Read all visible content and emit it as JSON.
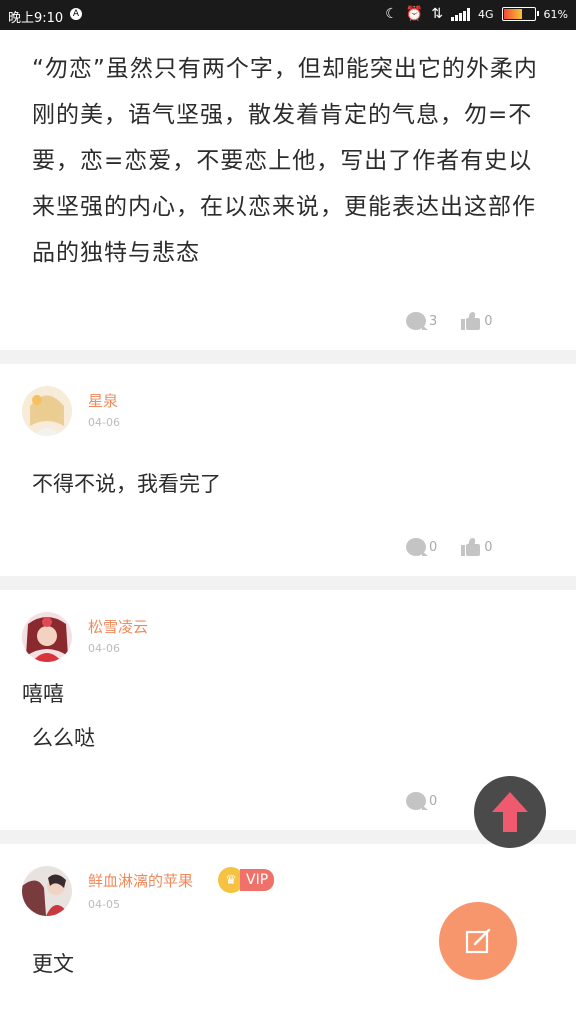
{
  "status_bar": {
    "time": "晚上9:10",
    "notification_badge": "A",
    "network": "4G",
    "battery": "61%",
    "icons": [
      "moon-icon",
      "alarm-icon",
      "data-transfer-icon",
      "signal-icon",
      "battery-icon"
    ]
  },
  "posts": [
    {
      "text": "“勿恋”虽然只有两个字，但却能突出它的外柔内刚的美，语气坚强，散发着肯定的气息，勿=不要，恋=恋爱，不要恋上他，写出了作者有史以来坚强的内心，在以恋来说，更能表达出这部作品的独特与悲态",
      "reply_count": "3",
      "like_count": "0"
    }
  ],
  "comments": [
    {
      "username": "星泉",
      "date": "04-06",
      "text": "不得不说，我看完了",
      "reply_count": "0",
      "like_count": "0"
    },
    {
      "username": "松雪凌云",
      "date": "04-06",
      "text_line1": "嘻嘻",
      "text_line2": "么么哒",
      "reply_count": "0"
    },
    {
      "username": "鲜血淋漓的苹果",
      "date": "04-05",
      "badge": "VIP",
      "text": "更文"
    }
  ],
  "colors": {
    "accent": "#f08a5d",
    "fab_edit": "#f7956c",
    "fab_up": "#4a4a4a",
    "arrow": "#f05a6e"
  }
}
